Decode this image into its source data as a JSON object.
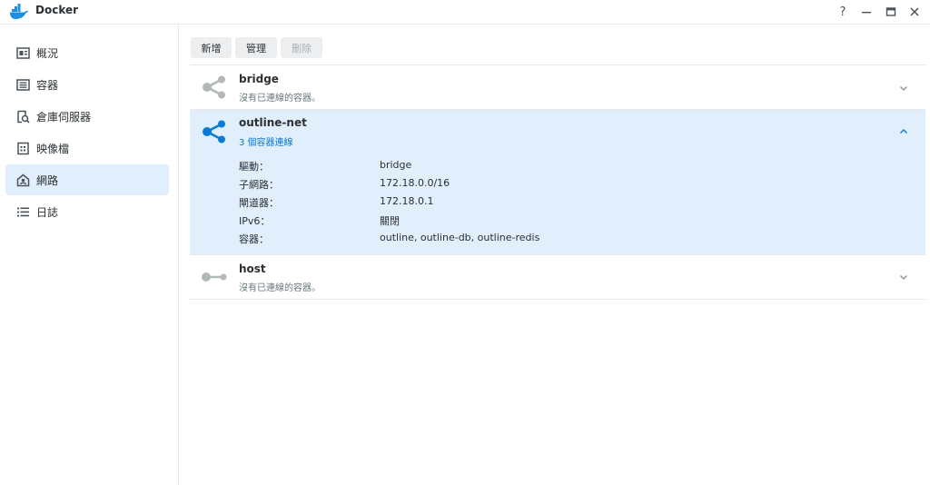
{
  "window": {
    "title": "Docker",
    "help": "?",
    "minimize": "—",
    "maximize": "□",
    "close": "✕"
  },
  "sidebar": {
    "items": [
      {
        "label": "概況",
        "icon": "overview-icon"
      },
      {
        "label": "容器",
        "icon": "container-icon"
      },
      {
        "label": "倉庫伺服器",
        "icon": "registry-icon"
      },
      {
        "label": "映像檔",
        "icon": "image-icon"
      },
      {
        "label": "網路",
        "icon": "network-icon",
        "active": true
      },
      {
        "label": "日誌",
        "icon": "log-icon"
      }
    ]
  },
  "toolbar": {
    "add": "新增",
    "manage": "管理",
    "delete": "刪除"
  },
  "networks": [
    {
      "name": "bridge",
      "status": "沒有已連線的容器。",
      "expanded": false
    },
    {
      "name": "outline-net",
      "status": "3 個容器連線",
      "expanded": true,
      "details": [
        {
          "label": "驅動：",
          "value": "bridge"
        },
        {
          "label": "子網路：",
          "value": "172.18.0.0/16"
        },
        {
          "label": "閘道器：",
          "value": "172.18.0.1"
        },
        {
          "label": "IPv6：",
          "value": "關閉"
        },
        {
          "label": "容器：",
          "value": "outline, outline-db, outline-redis"
        }
      ]
    },
    {
      "name": "host",
      "status": "沒有已連線的容器。",
      "expanded": false
    }
  ],
  "colors": {
    "accent": "#0a7bd6",
    "active_bg": "#e1eefb",
    "icon_gray": "#b3b8bb"
  }
}
